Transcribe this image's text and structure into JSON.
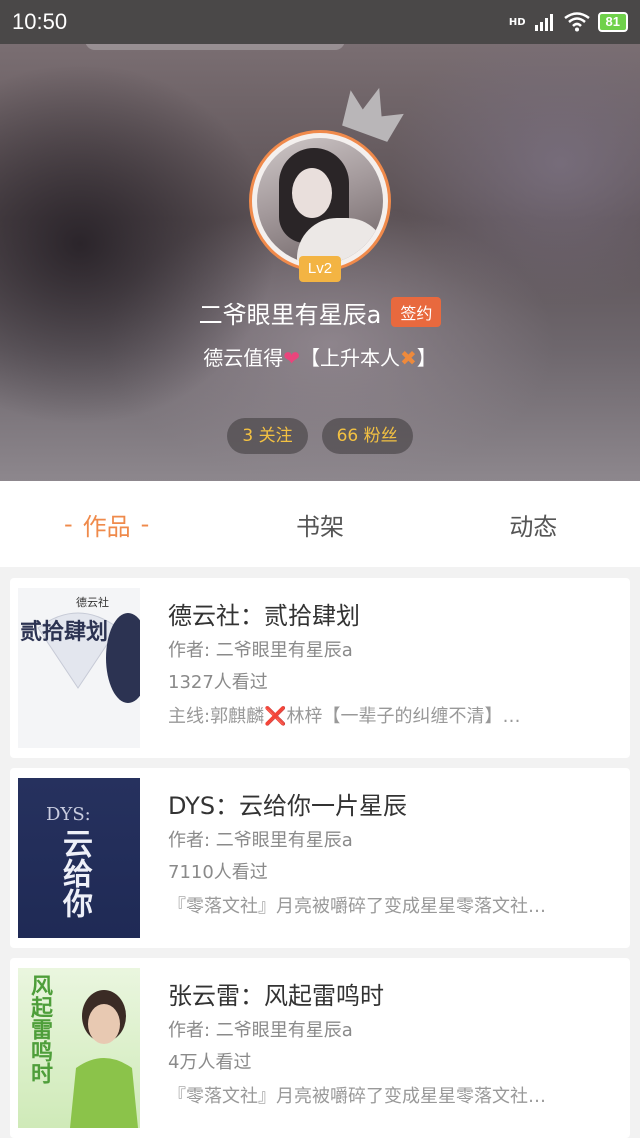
{
  "status_bar": {
    "time": "10:50",
    "network": "HD",
    "battery": "81"
  },
  "profile": {
    "level": "Lv2",
    "name": "二爷眼里有星辰a",
    "sign_badge": "签约",
    "bio_text_1": "德云值得",
    "bio_text_2": "【上升本人",
    "bio_text_3": "】",
    "stats": {
      "following": "3 关注",
      "fans": "66 粉丝"
    }
  },
  "tabs": [
    {
      "label": "作品",
      "dash": "-"
    },
    {
      "label": "书架"
    },
    {
      "label": "动态"
    }
  ],
  "books": [
    {
      "title": "德云社：贰拾肆划",
      "author": "作者: 二爷眼里有星辰a",
      "views": "1327人看过",
      "desc": "主线:郭麒麟❌林梓【一辈子的纠缠不清】…",
      "cover_title": "贰拾肆划",
      "cover_subtitle": "德云社"
    },
    {
      "title": "DYS：云给你一片星辰",
      "author": "作者: 二爷眼里有星辰a",
      "views": "7110人看过",
      "desc": "『零落文社』月亮被嚼碎了变成星星零落文社…",
      "cover_title": "云给你",
      "cover_subtitle": "DYS:"
    },
    {
      "title": "张云雷：风起雷鸣时",
      "author": "作者: 二爷眼里有星辰a",
      "views": "4万人看过",
      "desc": "『零落文社』月亮被嚼碎了变成星星零落文社…",
      "cover_title": "风起雷鸣时"
    }
  ],
  "colors": {
    "accent": "#ef8a4b",
    "level": "#f3b443",
    "sign": "#e8693e",
    "stat_text": "#f3c142"
  }
}
